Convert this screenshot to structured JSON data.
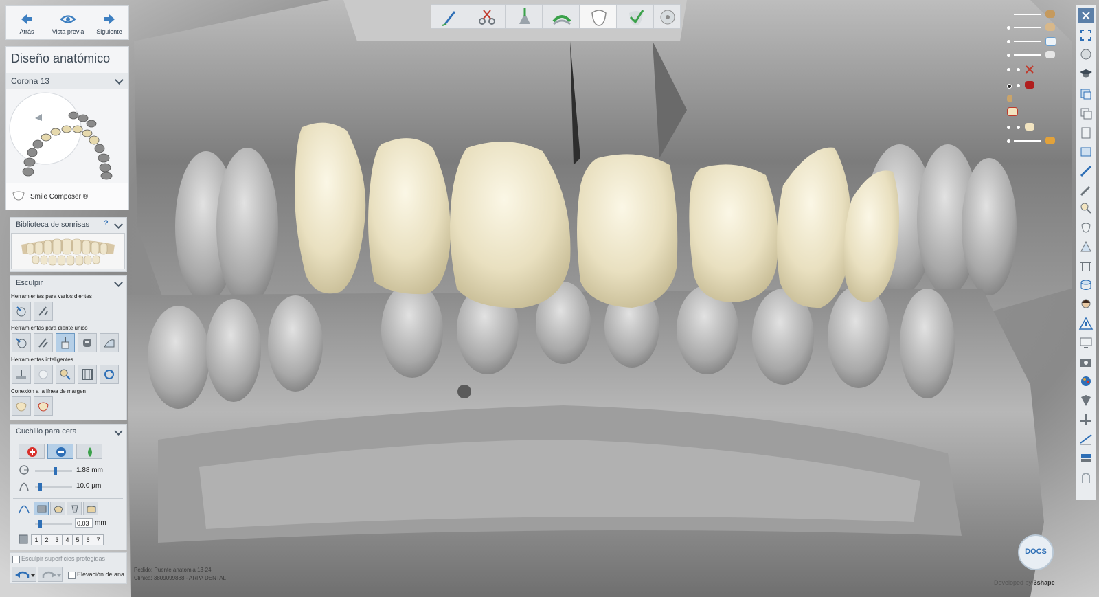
{
  "nav": {
    "back_label": "Atrás",
    "preview_label": "Vista previa",
    "next_label": "Siguiente"
  },
  "panel": {
    "title": "Diseño anatómico",
    "crown_label": "Corona 13",
    "smile_composer_label": "Smile Composer ®"
  },
  "smile_library": {
    "header": "Biblioteca de sonrisas",
    "help": "?"
  },
  "sculpt": {
    "header": "Esculpir",
    "multi_tooth_label": "Herramientas para varios dientes",
    "single_tooth_label": "Herramientas para diente único",
    "smart_tools_label": "Herramientas inteligentes",
    "margin_label": "Conexión a la línea de margen"
  },
  "wax_knife": {
    "header": "Cuchillo para cera",
    "radius_value": "1.88 mm",
    "radius_level": 0.55,
    "strength_value": "10.0 µm",
    "strength_level": 0.1,
    "offset_value": "0.03",
    "offset_unit": "mm",
    "offset_level": 0.1,
    "levels": [
      "1",
      "2",
      "3",
      "4",
      "5",
      "6",
      "7"
    ]
  },
  "bottom": {
    "protect_label": "Esculpir superficies protegidas",
    "elevation_label": "Elevación de ana"
  },
  "status": {
    "order": "Pedido:   Puente anatomia 13-24",
    "clinic": "Clínica:   3809099888 - ARPA DENTAL"
  },
  "branding": {
    "docs_badge": "DOCS",
    "developed_by": "Developed by",
    "company": "3shape"
  },
  "colors": {
    "accent": "#2e6fb6",
    "crown": "#ece5c9",
    "model": "#9c9c9c"
  }
}
